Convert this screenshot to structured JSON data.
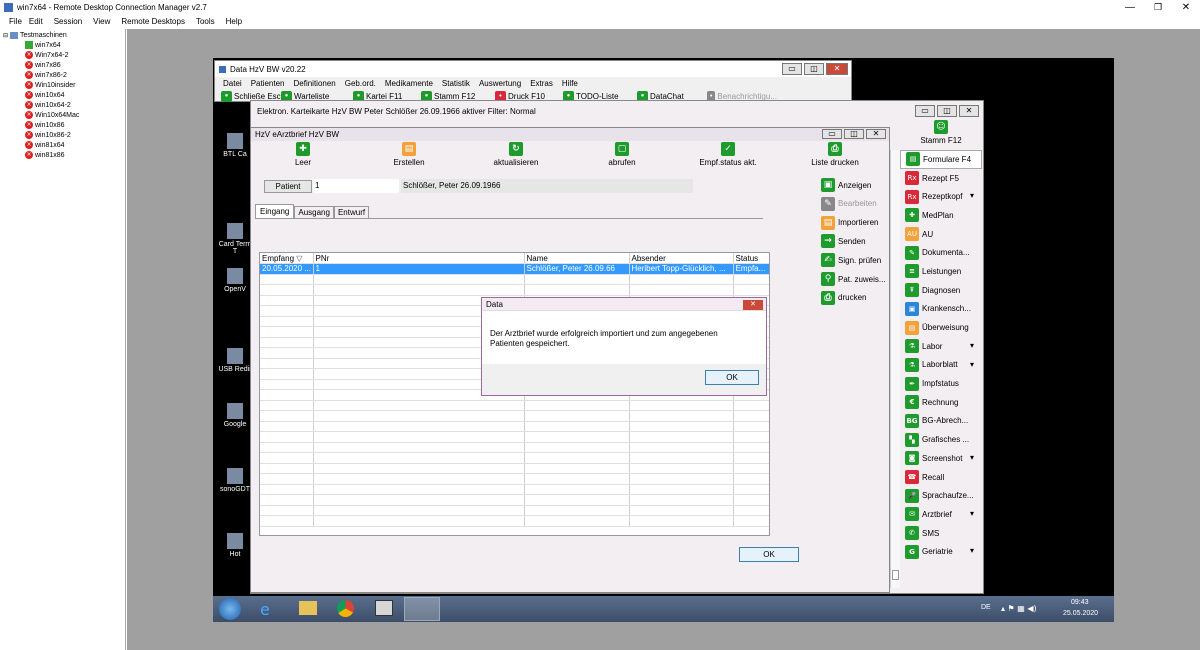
{
  "outer_window": {
    "title": "win7x64 - Remote Desktop Connection Manager v2.7",
    "menu": [
      "File",
      "Edit",
      "Session",
      "View",
      "Remote Desktops",
      "Tools",
      "Help"
    ]
  },
  "tree": {
    "root": "Testmaschinen",
    "items": [
      {
        "label": "win7x64",
        "state": "connected"
      },
      {
        "label": "Win7x64-2",
        "state": "error"
      },
      {
        "label": "win7x86",
        "state": "error"
      },
      {
        "label": "win7x86-2",
        "state": "error"
      },
      {
        "label": "Win10insider",
        "state": "error"
      },
      {
        "label": "win10x64",
        "state": "error"
      },
      {
        "label": "win10x64-2",
        "state": "error"
      },
      {
        "label": "Win10x64Mac",
        "state": "error"
      },
      {
        "label": "win10x86",
        "state": "error"
      },
      {
        "label": "win10x86-2",
        "state": "error"
      },
      {
        "label": "win81x64",
        "state": "error"
      },
      {
        "label": "win81x86",
        "state": "error"
      }
    ]
  },
  "desktop_icons": [
    "BTL Ca",
    "Card Term\nT",
    "OpenV",
    "USB Redir",
    "Google",
    "sonoGDT",
    "Hot"
  ],
  "app": {
    "title": "Data HzV BW v20.22",
    "menu": [
      "Datei",
      "Patienten",
      "Definitionen",
      "Geb.ord.",
      "Medikamente",
      "Statistik",
      "Auswertung",
      "Extras",
      "Hilfe"
    ],
    "toolbar": [
      "Schließe Esc",
      "Warteliste",
      "Kartei F11",
      "Stamm F12",
      "Druck F10",
      "TODO-Liste",
      "DataChat",
      "Benachrichtigu..."
    ]
  },
  "kartei": {
    "title": "Elektron. Karteikarte HzV BW Peter Schlößer 26.09.1966  aktiver Filter: Normal",
    "stamm": "Stamm F12",
    "sidebar": [
      {
        "label": "Formulare F4",
        "color": "g",
        "icon": "▤",
        "dropdown": false
      },
      {
        "label": "Rezept F5",
        "color": "r",
        "icon": "Rx",
        "dropdown": false
      },
      {
        "label": "Rezeptkopf",
        "color": "r",
        "icon": "Rx",
        "dropdown": true
      },
      {
        "label": "MedPlan",
        "color": "g",
        "icon": "✚",
        "dropdown": false
      },
      {
        "label": "AU",
        "color": "o",
        "icon": "AU",
        "dropdown": false
      },
      {
        "label": "Dokumenta...",
        "color": "g",
        "icon": "✎",
        "dropdown": false
      },
      {
        "label": "Leistungen",
        "color": "g",
        "icon": "≡",
        "dropdown": false
      },
      {
        "label": "Diagnosen",
        "color": "g",
        "icon": "☤",
        "dropdown": false
      },
      {
        "label": "Krankensch...",
        "color": "b",
        "icon": "▣",
        "dropdown": false
      },
      {
        "label": "Überweisung",
        "color": "o",
        "icon": "▤",
        "dropdown": false
      },
      {
        "label": "Labor",
        "color": "g",
        "icon": "⚗",
        "dropdown": true
      },
      {
        "label": "Laborblatt",
        "color": "g",
        "icon": "⚗",
        "dropdown": true
      },
      {
        "label": "Impfstatus",
        "color": "g",
        "icon": "✒",
        "dropdown": false
      },
      {
        "label": "Rechnung",
        "color": "g",
        "icon": "€",
        "dropdown": false
      },
      {
        "label": "BG-Abrech...",
        "color": "g",
        "icon": "BG",
        "dropdown": false
      },
      {
        "label": "Grafisches ...",
        "color": "g",
        "icon": "▚",
        "dropdown": false
      },
      {
        "label": "Screenshot",
        "color": "g",
        "icon": "◙",
        "dropdown": true
      },
      {
        "label": "Recall",
        "color": "r",
        "icon": "☎",
        "dropdown": false
      },
      {
        "label": "Sprachaufze...",
        "color": "g",
        "icon": "🎤",
        "dropdown": false
      },
      {
        "label": "Arztbrief",
        "color": "g",
        "icon": "✉",
        "dropdown": true
      },
      {
        "label": "SMS",
        "color": "g",
        "icon": "✆",
        "dropdown": false
      },
      {
        "label": "Geriatrie",
        "color": "g",
        "icon": "G",
        "dropdown": true
      }
    ]
  },
  "arztbrief": {
    "title": "HzV eArztbrief HzV BW",
    "toolbar": [
      "Leer",
      "Erstellen",
      "aktualisieren",
      "abrufen",
      "Empf.status akt.",
      "Liste drucken"
    ],
    "patient_button": "Patient",
    "patient_id": "1",
    "patient_name": "Schlößer, Peter 26.09.1966",
    "tabs": [
      "Eingang",
      "Ausgang",
      "Entwurf"
    ],
    "columns": [
      "Empfang",
      "PNr",
      "Name",
      "Absender",
      "Status"
    ],
    "sort_mark": "▽",
    "rows": [
      [
        "20.05.2020 ...",
        "1",
        "Schlößer, Peter 26.09.66",
        "Heribert Topp-Glücklich, ...",
        "Empfa..."
      ]
    ],
    "actions": [
      {
        "label": "Anzeigen",
        "enabled": true
      },
      {
        "label": "Bearbeiten",
        "enabled": false
      },
      {
        "label": "Importieren",
        "enabled": true
      },
      {
        "label": "Senden",
        "enabled": true
      },
      {
        "label": "Sign. prüfen",
        "enabled": true
      },
      {
        "label": "Pat. zuweis...",
        "enabled": true
      },
      {
        "label": "drucken",
        "enabled": true
      }
    ],
    "ok_button": "OK"
  },
  "dialog": {
    "title": "Data",
    "message": "Der Arztbrief wurde erfolgreich importiert und zum angegebenen Patienten gespeichert.",
    "ok": "OK"
  },
  "taskbar": {
    "lang": "DE",
    "time": "09:43",
    "date": "25.05.2020"
  }
}
